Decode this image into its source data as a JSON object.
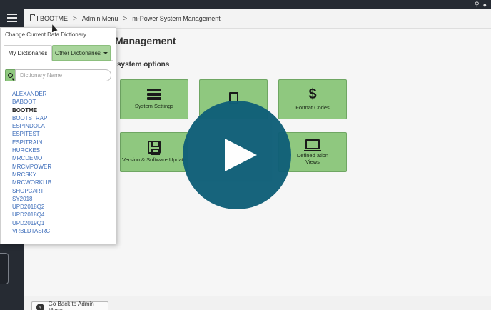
{
  "breadcrumb": {
    "items": [
      "BOOTME",
      "Admin Menu",
      "m-Power System Management"
    ],
    "separator": ">"
  },
  "page": {
    "title": "Management",
    "section_title": "system options"
  },
  "tiles": [
    {
      "label": "System Settings",
      "icon": "list-icon"
    },
    {
      "label": "",
      "icon": "document-icon"
    },
    {
      "label": "Format Codes",
      "icon": "dollar-icon",
      "glyph": "$"
    },
    {
      "label": "Version & Software Update",
      "icon": "floppy-disk-icon"
    },
    {
      "label": "Defined ation Views",
      "icon": "laptop-icon"
    }
  ],
  "dictionary_panel": {
    "title": "Change Current Data Dictionary",
    "tabs": {
      "my": "My Dictionaries",
      "other": "Other Dictionaries"
    },
    "search_placeholder": "Dictionary Name",
    "current": "BOOTME",
    "items": [
      "ALEXANDER",
      "BABOOT",
      "BOOTME",
      "BOOTSTRAP",
      "ESPINDOLA",
      "ESPITEST",
      "ESPITRAIN",
      "HURCKES",
      "MRCDEMO",
      "MRCMPOWER",
      "MRCSKY",
      "MRCWORKLIB",
      "SHOPCART",
      "SY2018",
      "UPD2018Q2",
      "UPD2018Q4",
      "UPD2019Q1",
      "VRBLDTASRC"
    ]
  },
  "footer": {
    "back_label": "Go Back to Admin Menu"
  },
  "colors": {
    "tile_green": "#8fc87f",
    "play_overlay": "#0f5f78",
    "link_blue": "#3d6dba",
    "topbar": "#262b33"
  }
}
